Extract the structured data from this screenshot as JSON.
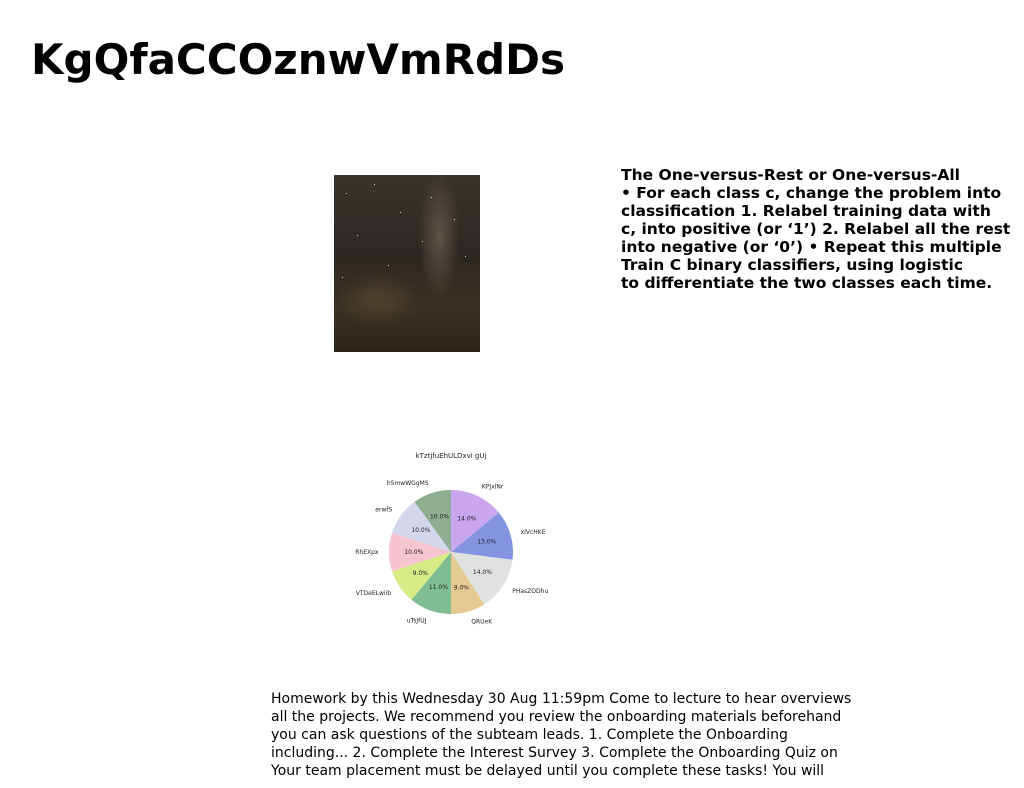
{
  "title": "KgQfaCCOznwVmRdDs",
  "photo": {
    "description_icon": "night-sky-photo"
  },
  "slide_text": {
    "lines": [
      "The One-versus-Rest or One-versus-All",
      "• For each class c, change the problem into",
      "classification 1. Relabel training data with",
      "c, into positive (or ‘1’) 2. Relabel all the rest",
      "into negative (or ‘0’) • Repeat this multiple",
      "Train C binary classifiers, using logistic",
      "to differentiate the two classes each time."
    ]
  },
  "chart_data": {
    "type": "pie",
    "title": "kTztjfuEhULDxvi gUj",
    "categories": [
      "KPJxlNr",
      "xlVcHKE",
      "PHasZODhu",
      "QRUeK",
      "uTsJfUJ",
      "VTDeELwiib",
      "RhEXpx",
      "erwfS",
      "hSmwWGgMS"
    ],
    "values": [
      14.0,
      13.0,
      14.0,
      9.0,
      11.0,
      9.0,
      10.0,
      10.0,
      10.0
    ],
    "value_labels": [
      "14.0%",
      "13.0%",
      "14.0%",
      "9.0%",
      "11.0%",
      "9.0%",
      "10.0%",
      "10.0%",
      "10.0%"
    ],
    "colors": [
      "#c9a6ee",
      "#8494e0",
      "#e0e2e1",
      "#e5c993",
      "#80bd93",
      "#d7eb86",
      "#f5c4cf",
      "#d4d6ec",
      "#8fae92"
    ],
    "start_angle_deg": 90,
    "direction": "clockwise"
  },
  "notes": {
    "lines": [
      "Homework by this Wednesday 30 Aug 11:59pm Come to lecture to hear overviews",
      "all the projects. We recommend you review the onboarding materials beforehand",
      "you can ask questions of the subteam leads. 1. Complete the Onboarding",
      "including... 2. Complete the Interest Survey 3. Complete the Onboarding Quiz on",
      "Your team placement must be delayed until you complete these tasks! You will"
    ]
  }
}
